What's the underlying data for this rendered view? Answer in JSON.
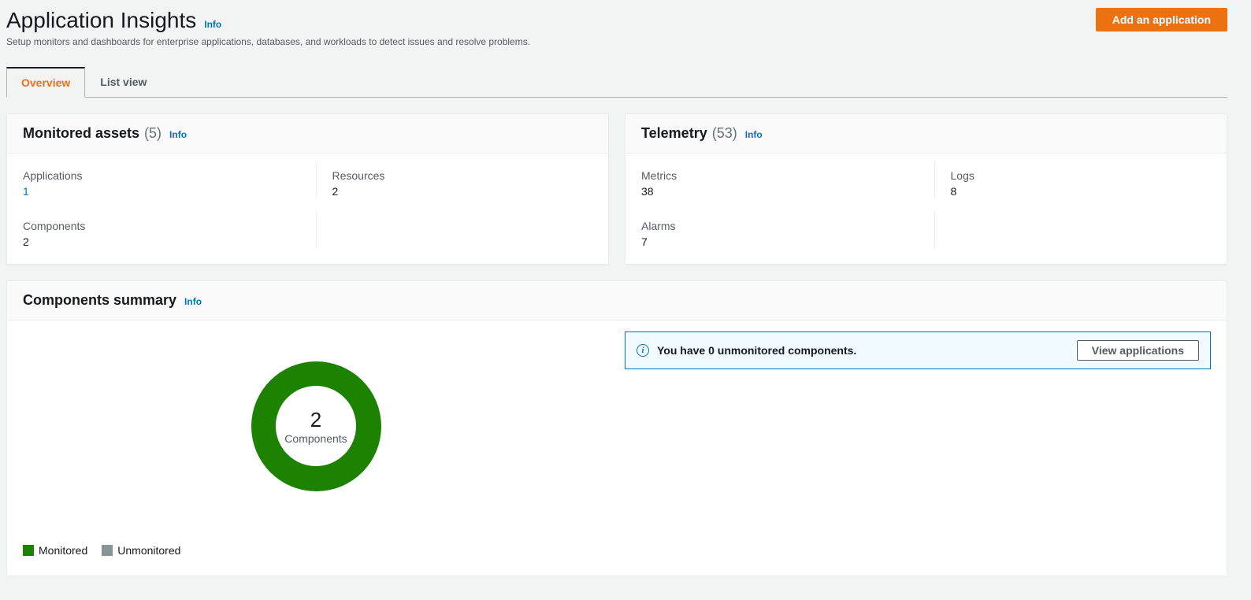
{
  "header": {
    "title": "Application Insights",
    "info": "Info",
    "subtitle": "Setup monitors and dashboards for enterprise applications, databases, and workloads to detect issues and resolve problems.",
    "add_button": "Add an application"
  },
  "tabs": {
    "overview": "Overview",
    "list_view": "List view"
  },
  "monitored_assets": {
    "title": "Monitored assets",
    "count": "(5)",
    "info": "Info",
    "applications_label": "Applications",
    "applications_value": "1",
    "resources_label": "Resources",
    "resources_value": "2",
    "components_label": "Components",
    "components_value": "2"
  },
  "telemetry": {
    "title": "Telemetry",
    "count": "(53)",
    "info": "Info",
    "metrics_label": "Metrics",
    "metrics_value": "38",
    "logs_label": "Logs",
    "logs_value": "8",
    "alarms_label": "Alarms",
    "alarms_value": "7"
  },
  "components_summary": {
    "title": "Components summary",
    "info": "Info",
    "donut_value": "2",
    "donut_label": "Components",
    "legend_monitored": "Monitored",
    "legend_unmonitored": "Unmonitored",
    "notice_text": "You have 0 unmonitored components.",
    "view_applications": "View applications"
  },
  "chart_data": {
    "type": "pie",
    "title": "Components summary",
    "series": [
      {
        "name": "Monitored",
        "value": 2,
        "color": "#1d8102"
      },
      {
        "name": "Unmonitored",
        "value": 0,
        "color": "#879596"
      }
    ],
    "center_label": "Components",
    "center_value": 2
  }
}
